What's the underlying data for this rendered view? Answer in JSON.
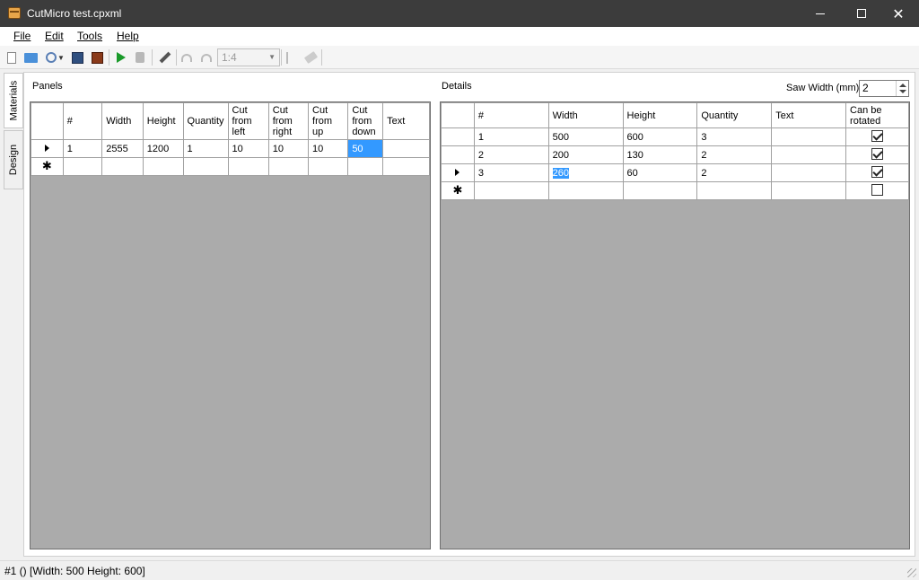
{
  "window": {
    "title": "CutMicro test.cpxml",
    "minimize_glyph": "",
    "maximize_glyph": "",
    "close_glyph": "✕"
  },
  "menu": {
    "file": "File",
    "edit": "Edit",
    "tools": "Tools",
    "help": "Help"
  },
  "toolbar": {
    "zoom_value": "1:4"
  },
  "side_tabs": {
    "materials": "Materials",
    "design": "Design"
  },
  "panels": {
    "label": "Panels",
    "headers": [
      "#",
      "Width",
      "Height",
      "Quantity",
      "Cut from left",
      "Cut from right",
      "Cut from up",
      "Cut from down",
      "Text"
    ],
    "rows": [
      {
        "num": "1",
        "width": "2555",
        "height": "1200",
        "quantity": "1",
        "cut_left": "10",
        "cut_right": "10",
        "cut_up": "10",
        "cut_down": "50",
        "text": ""
      }
    ]
  },
  "details": {
    "label": "Details",
    "saw_width_label": "Saw Width (mm)",
    "saw_width_value": "2",
    "headers": [
      "#",
      "Width",
      "Height",
      "Quantity",
      "Text",
      "Can be rotated"
    ],
    "rows": [
      {
        "num": "1",
        "width": "500",
        "height": "600",
        "quantity": "3",
        "text": "",
        "rotated": true
      },
      {
        "num": "2",
        "width": "200",
        "height": "130",
        "quantity": "2",
        "text": "",
        "rotated": true
      },
      {
        "num": "3",
        "width": "260",
        "height": "60",
        "quantity": "2",
        "text": "",
        "rotated": true
      }
    ],
    "new_row_rotated": false
  },
  "status": {
    "text": "#1 () [Width: 500 Height: 600]"
  }
}
